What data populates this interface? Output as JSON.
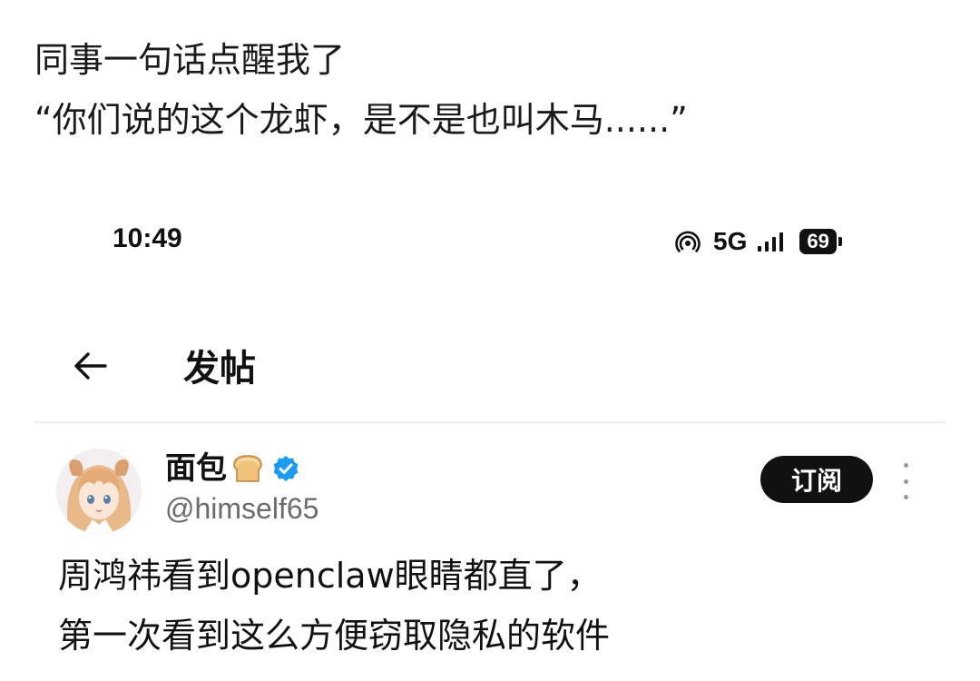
{
  "caption": {
    "line1": "同事一句话点醒我了",
    "line2": "“你们说的这个龙虾，是不是也叫木马......”"
  },
  "status_bar": {
    "time": "10:49",
    "network": "5G",
    "battery": "69",
    "icons": [
      "hotspot-icon",
      "signal-icon",
      "battery-icon"
    ]
  },
  "header": {
    "back_icon": "arrow-left-icon",
    "title": "发帖"
  },
  "post": {
    "author": {
      "name": "面包",
      "emoji": "bread-icon",
      "verified_icon": "verified-badge-icon",
      "handle": "@himself65"
    },
    "subscribe_label": "订阅",
    "more_icon": "more-vertical-icon",
    "text_lines": [
      "周鸿祎看到openclaw眼睛都直了，",
      "第一次看到这么方便窃取隐私的软件"
    ]
  },
  "colors": {
    "verified": "#1d9bf0",
    "button_bg": "#111111",
    "handle_gray": "#6b6b6b"
  }
}
